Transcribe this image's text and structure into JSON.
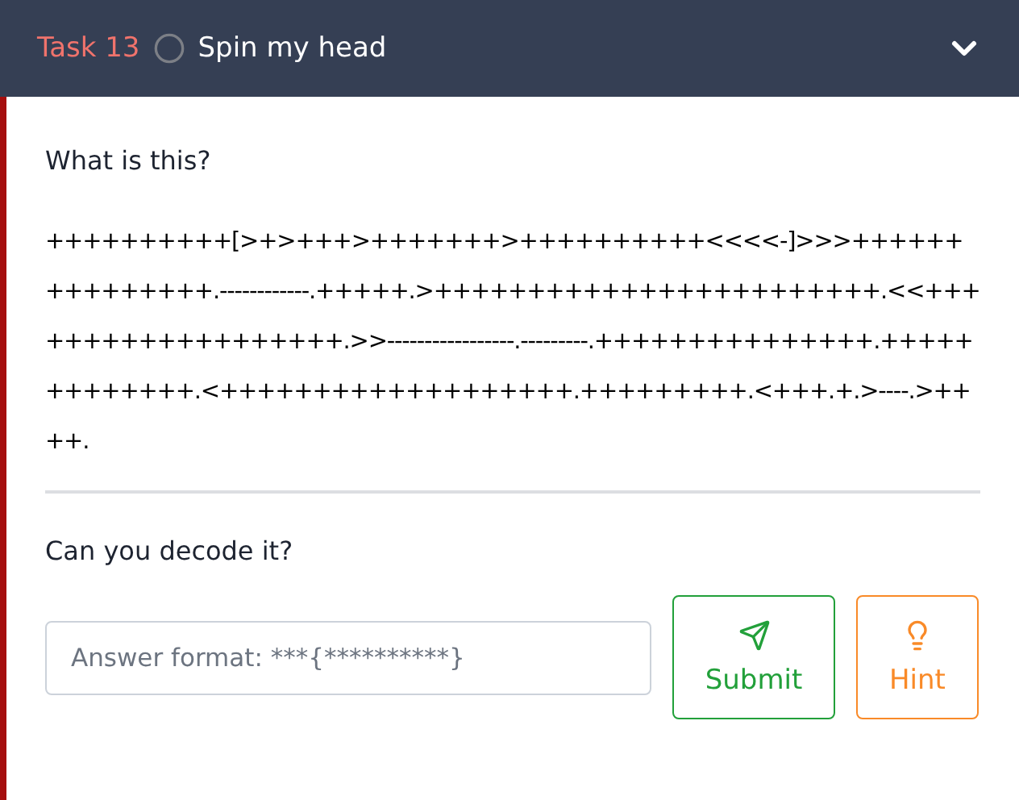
{
  "header": {
    "task_label": "Task 13",
    "title": "Spin my head"
  },
  "question": "What is this?",
  "code": "++++++++++[>+>+++>+++++++>++++++++++<<<<-]>>>+++++++++++++++.------------.+++++.>++++++++++++++++++++++++.<<+++++++++++++++++++.>>-----------------.---------.+++++++++++++++.+++++++++++++.<+++++++++++++++++++.+++++++++.<+++.+.>----.>++++.",
  "prompt": "Can you decode it?",
  "answer": {
    "placeholder": "Answer format: ***{**********}"
  },
  "buttons": [
    {
      "kind": "submit",
      "label": "Submit"
    },
    {
      "kind": "hint",
      "label": "Hint"
    }
  ]
}
